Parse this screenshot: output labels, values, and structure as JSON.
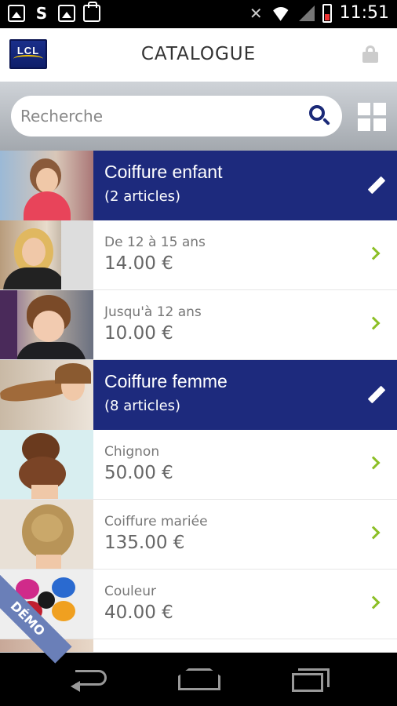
{
  "status_bar": {
    "time": "11:51",
    "left_icons": [
      "image-notification-icon",
      "s-notification-icon",
      "gallery-notification-icon",
      "bag-notification-icon"
    ],
    "right_icons": [
      "mute-icon",
      "wifi-icon",
      "signal-icon",
      "battery-icon"
    ]
  },
  "header": {
    "logo_text": "LCL",
    "title": "CATALOGUE",
    "lock_icon": "lock-icon"
  },
  "search": {
    "placeholder": "Recherche",
    "value": "",
    "search_icon": "search-icon",
    "grid_icon": "grid-view-icon"
  },
  "catalog": {
    "categories": [
      {
        "title": "Coiffure enfant",
        "count": "(2 articles)",
        "items": [
          {
            "name": "De 12 à 15 ans",
            "price": "14.00 €"
          },
          {
            "name": "Jusqu'à 12 ans",
            "price": "10.00 €"
          }
        ]
      },
      {
        "title": "Coiffure femme",
        "count": "(8 articles)",
        "items": [
          {
            "name": "Chignon",
            "price": "50.00 €"
          },
          {
            "name": "Coiffure mariée",
            "price": "135.00 €"
          },
          {
            "name": "Couleur",
            "price": "40.00 €"
          }
        ]
      }
    ]
  },
  "demo_badge": "DÉMO",
  "colors": {
    "category_bg": "#1d2a7d",
    "chevron": "#8cbf26",
    "search_icon": "#1b2a78"
  }
}
